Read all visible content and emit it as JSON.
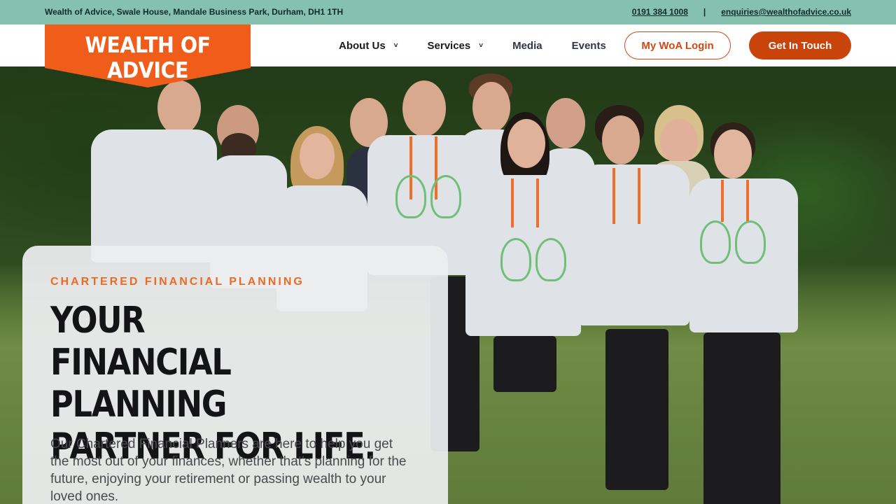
{
  "topbar": {
    "address": "Wealth of Advice, Swale House, Mandale Business Park, Durham, DH1 1TH",
    "phone": "0191 384 1008",
    "separator": "|",
    "email": "enquiries@wealthofadvice.co.uk"
  },
  "logo": {
    "text": "WEALTH OF ADVICE",
    "color": "#f05d1a"
  },
  "nav": {
    "items": [
      {
        "label": "About Us",
        "has_dropdown": true
      },
      {
        "label": "Services",
        "has_dropdown": true
      },
      {
        "label": "Media",
        "has_dropdown": false
      },
      {
        "label": "Events",
        "has_dropdown": false
      }
    ],
    "chevron": "˅",
    "login_label": "My WoA Login",
    "cta_label": "Get In Touch"
  },
  "hero": {
    "eyebrow": "CHARTERED FINANCIAL PLANNING",
    "headline": [
      "YOUR",
      "FINANCIAL PLANNING",
      "PARTNER FOR LIFE."
    ],
    "intro": "Our Chartered Financial Planners are here to help you get the most out of your finances, whether that's planning for the future, enjoying your retirement or passing wealth to your loved ones."
  },
  "colors": {
    "accent": "#c9440b",
    "topbar_bg": "#86c1b0",
    "eyebrow": "#ea6b25"
  }
}
